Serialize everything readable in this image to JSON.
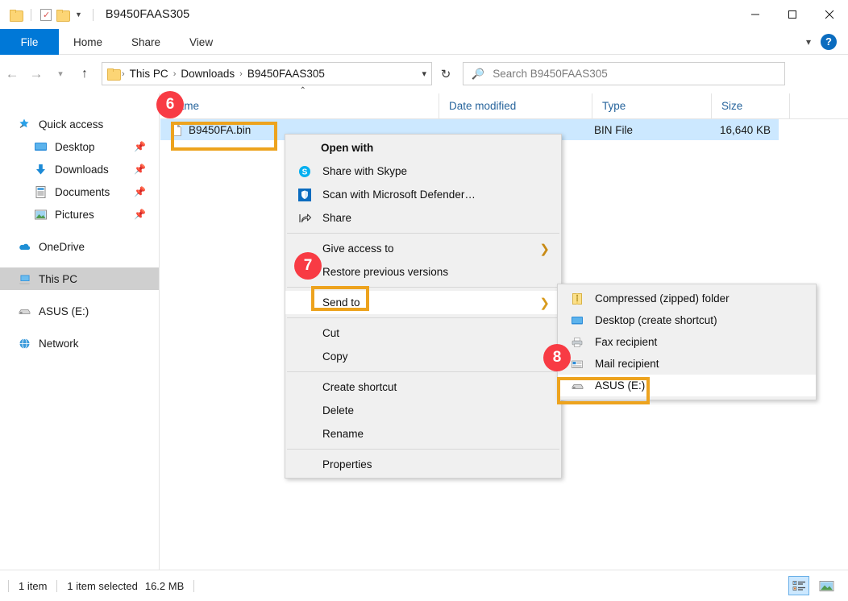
{
  "window": {
    "title": "B9450FAAS305",
    "quick_access_icons": [
      "folder-icon",
      "checkbox-icon",
      "folder-icon",
      "caret-down-icon"
    ],
    "controls": {
      "minimize": "minimize-icon",
      "maximize": "maximize-icon",
      "close": "close-icon"
    }
  },
  "ribbon": {
    "tabs": [
      {
        "label": "File",
        "active": true
      },
      {
        "label": "Home",
        "active": false
      },
      {
        "label": "Share",
        "active": false
      },
      {
        "label": "View",
        "active": false
      }
    ],
    "expand_icon": "chevron-down-icon",
    "help_label": "?"
  },
  "address_bar": {
    "back": "arrow-left-icon",
    "forward": "arrow-right-icon",
    "recent": "chevron-down-icon",
    "up": "arrow-up-icon",
    "breadcrumbs": [
      "This PC",
      "Downloads",
      "B9450FAAS305"
    ],
    "separator": "›",
    "dropdown": "chevron-down-icon",
    "refresh": "↻"
  },
  "search": {
    "icon": "search-icon",
    "placeholder": "Search B9450FAAS305",
    "value": ""
  },
  "sidebar": {
    "items": [
      {
        "label": "Quick access",
        "icon": "star-pin-icon",
        "level": 0,
        "pinned": false,
        "selected": false
      },
      {
        "label": "Desktop",
        "icon": "desktop-icon",
        "level": 1,
        "pinned": true,
        "selected": false
      },
      {
        "label": "Downloads",
        "icon": "downloads-icon",
        "level": 1,
        "pinned": true,
        "selected": false
      },
      {
        "label": "Documents",
        "icon": "documents-icon",
        "level": 1,
        "pinned": true,
        "selected": false
      },
      {
        "label": "Pictures",
        "icon": "pictures-icon",
        "level": 1,
        "pinned": true,
        "selected": false
      },
      {
        "label": "OneDrive",
        "icon": "cloud-icon",
        "level": 0,
        "pinned": false,
        "selected": false
      },
      {
        "label": "This PC",
        "icon": "computer-icon",
        "level": 0,
        "pinned": false,
        "selected": true
      },
      {
        "label": "ASUS (E:)",
        "icon": "drive-icon",
        "level": 0,
        "pinned": false,
        "selected": false
      },
      {
        "label": "Network",
        "icon": "network-icon",
        "level": 0,
        "pinned": false,
        "selected": false
      }
    ]
  },
  "file_list": {
    "columns": [
      "Name",
      "Date modified",
      "Type",
      "Size"
    ],
    "sort_indicator": "⌃",
    "rows": [
      {
        "icon": "file-icon",
        "name": "B9450FA.bin",
        "date_modified": "",
        "type": "BIN File",
        "size": "16,640 KB",
        "selected": true
      }
    ]
  },
  "context_menu": {
    "items": [
      {
        "label": "Open with",
        "icon": "",
        "bold": true,
        "submenu": false,
        "hover": false
      },
      {
        "label": "Share with Skype",
        "icon": "skype-icon",
        "bold": false,
        "submenu": false,
        "hover": false
      },
      {
        "label": "Scan with Microsoft Defender…",
        "icon": "defender-shield-icon",
        "bold": false,
        "submenu": false,
        "hover": false
      },
      {
        "label": "Share",
        "icon": "share-arrow-icon",
        "bold": false,
        "submenu": false,
        "hover": false
      },
      {
        "separator": true
      },
      {
        "label": "Give access to",
        "icon": "",
        "bold": false,
        "submenu": true,
        "hover": false
      },
      {
        "label": "Restore previous versions",
        "icon": "",
        "bold": false,
        "submenu": false,
        "hover": false
      },
      {
        "separator": true
      },
      {
        "label": "Send to",
        "icon": "",
        "bold": false,
        "submenu": true,
        "hover": true
      },
      {
        "separator": true
      },
      {
        "label": "Cut",
        "icon": "",
        "bold": false,
        "submenu": false,
        "hover": false
      },
      {
        "label": "Copy",
        "icon": "",
        "bold": false,
        "submenu": false,
        "hover": false
      },
      {
        "separator": true
      },
      {
        "label": "Create shortcut",
        "icon": "",
        "bold": false,
        "submenu": false,
        "hover": false
      },
      {
        "label": "Delete",
        "icon": "",
        "bold": false,
        "submenu": false,
        "hover": false
      },
      {
        "label": "Rename",
        "icon": "",
        "bold": false,
        "submenu": false,
        "hover": false
      },
      {
        "separator": true
      },
      {
        "label": "Properties",
        "icon": "",
        "bold": false,
        "submenu": false,
        "hover": false
      }
    ]
  },
  "send_to_submenu": {
    "items": [
      {
        "label": "Compressed (zipped) folder",
        "icon": "zip-folder-icon",
        "hover": false
      },
      {
        "label": "Desktop (create shortcut)",
        "icon": "desktop-icon",
        "hover": false
      },
      {
        "label": "Fax recipient",
        "icon": "fax-icon",
        "hover": false
      },
      {
        "label": "Mail recipient",
        "icon": "mail-icon",
        "hover": false
      },
      {
        "label": "ASUS (E:)",
        "icon": "drive-icon",
        "hover": true
      }
    ]
  },
  "annotations": {
    "badges": [
      {
        "number": "6",
        "target": "file-row-highlight"
      },
      {
        "number": "7",
        "target": "send-to-highlight"
      },
      {
        "number": "8",
        "target": "asus-drive-highlight"
      }
    ],
    "highlight_color": "#EDA31E",
    "badge_color": "#F83B44"
  },
  "status_bar": {
    "item_count": "1 item",
    "selection": "1 item selected",
    "selection_size": "16.2 MB",
    "views": [
      {
        "name": "details-view",
        "active": true
      },
      {
        "name": "large-icons-view",
        "active": false
      }
    ]
  }
}
